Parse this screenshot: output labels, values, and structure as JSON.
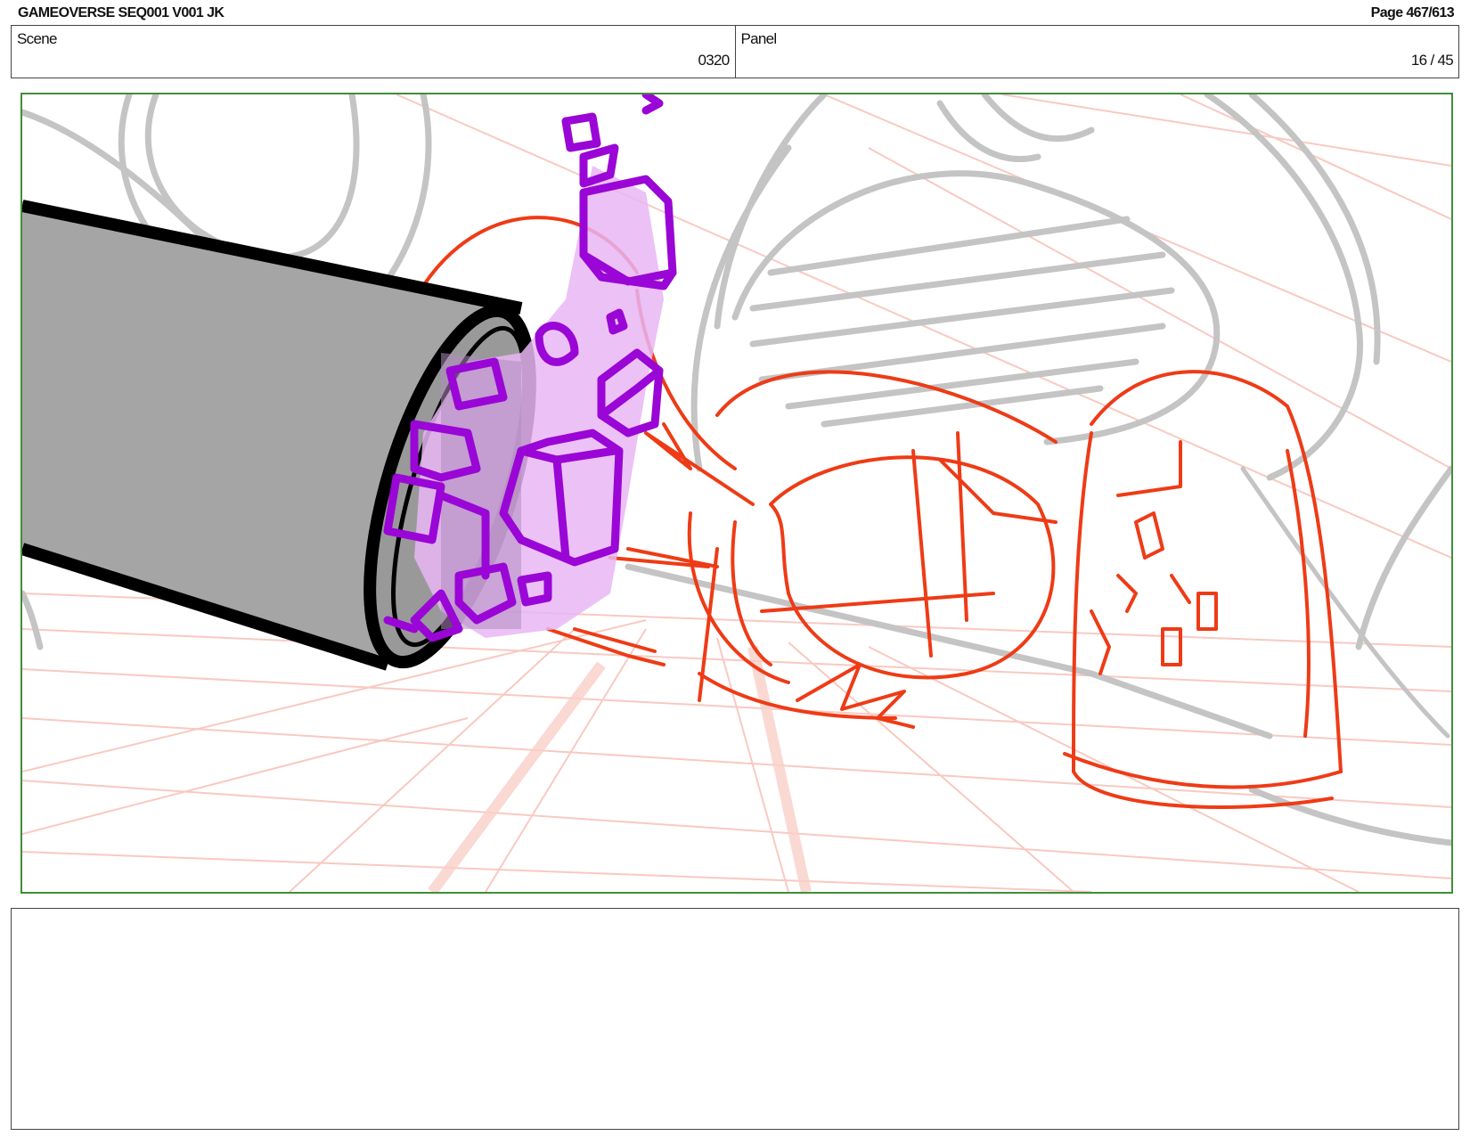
{
  "header": {
    "title": "GAMEOVERSE SEQ001 V001 JK",
    "page": "Page 467/613"
  },
  "info": {
    "scene_label": "Scene",
    "scene_value": "0320",
    "panel_label": "Panel",
    "panel_value": "16 / 45"
  },
  "notes": {
    "text": ""
  },
  "colors": {
    "frame_border": "#3f8e3a",
    "perspective_grid": "#f6b8ad",
    "background_sketch": "#c4c4c4",
    "character_sketch": "#ee3b16",
    "magic_effect": "#9a06d6",
    "magic_fill": "#e7b6f5",
    "cannon_fill": "#a5a5a5",
    "ink": "#000000"
  }
}
